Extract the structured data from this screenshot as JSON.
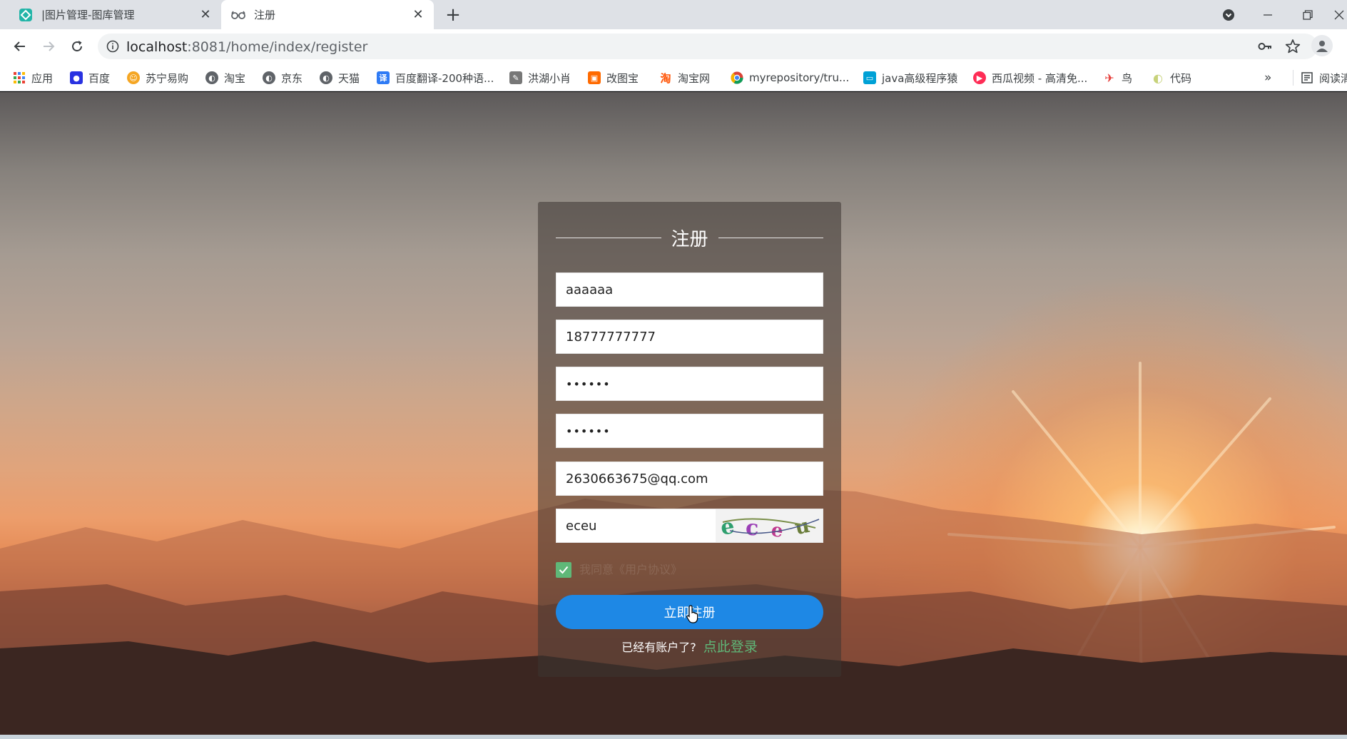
{
  "browser": {
    "tabs": [
      {
        "title": "|图片管理-图库管理",
        "icon": "app-logo-icon",
        "active": false
      },
      {
        "title": "注册",
        "icon": "incognito-glasses-icon",
        "active": true
      }
    ],
    "url_host": "localhost",
    "url_path": ":8081/home/index/register"
  },
  "bookmarks": [
    {
      "label": "应用",
      "icon": "apps-grid-icon",
      "color": "#4285f4"
    },
    {
      "label": "百度",
      "icon": "baidu-paw-icon",
      "color": "#2932e1"
    },
    {
      "label": "苏宁易购",
      "icon": "suning-icon",
      "color": "#f5a623"
    },
    {
      "label": "淘宝",
      "icon": "globe-icon",
      "color": "#5f6368"
    },
    {
      "label": "京东",
      "icon": "globe-icon",
      "color": "#5f6368"
    },
    {
      "label": "天猫",
      "icon": "globe-icon",
      "color": "#5f6368"
    },
    {
      "label": "百度翻译-200种语...",
      "icon": "translate-icon",
      "color": "#2f7bf5"
    },
    {
      "label": "洪湖小肖",
      "icon": "feather-icon",
      "color": "#555555"
    },
    {
      "label": "改图宝",
      "icon": "gaitubao-icon",
      "color": "#ff6a00"
    },
    {
      "label": "淘宝网",
      "icon": "taobao-icon",
      "color": "#ff5000"
    },
    {
      "label": "myrepository/tru...",
      "icon": "chrome-icon",
      "color": "#db4437"
    },
    {
      "label": "java高级程序猿",
      "icon": "bilibili-tv-icon",
      "color": "#00a1d6"
    },
    {
      "label": "西瓜视频 - 高清免...",
      "icon": "xigua-icon",
      "color": "#fe2c55"
    },
    {
      "label": "鸟",
      "icon": "bird-icon",
      "color": "#e53935"
    },
    {
      "label": "代码",
      "icon": "moon-icon",
      "color": "#c7d27a"
    },
    {
      "label": "阅读清",
      "icon": "reading-list-icon",
      "color": "#5f6368"
    }
  ],
  "more_bookmarks": "»",
  "form": {
    "title": "注册",
    "username": "aaaaaa",
    "phone": "18777777777",
    "password": "••••••",
    "confirm_password": "••••••",
    "email": "2630663675@qq.com",
    "captcha_value": "eceu",
    "captcha_image_text": "eceu",
    "agree_label": "我同意《用户协议》",
    "agree_checked": true,
    "submit_label": "立即注册",
    "have_account_text": "已经有账户了?",
    "login_link": "点此登录"
  },
  "colors": {
    "accent_blue": "#1e88e5",
    "link_green": "#5fb878",
    "checkbox_green": "#5fb878"
  }
}
